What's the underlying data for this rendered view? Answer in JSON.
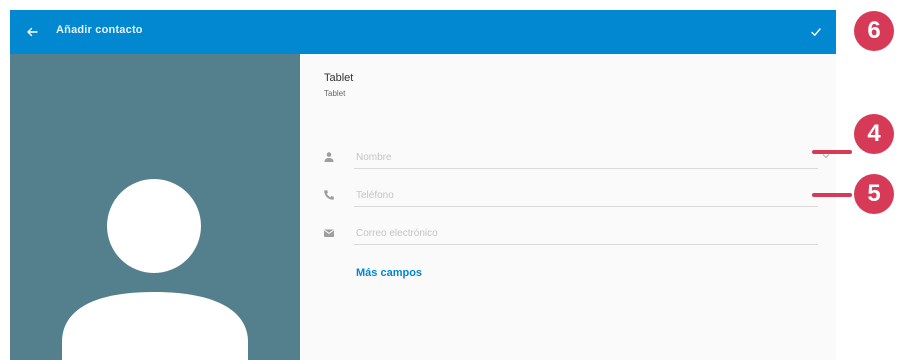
{
  "appbar": {
    "title": "Añadir contacto",
    "back_icon": "arrow-left-icon",
    "save_icon": "checkmark-icon",
    "background_color": "#0288d1"
  },
  "photo_panel": {
    "background_color": "#54808d",
    "avatar_icon": "person-silhouette-icon"
  },
  "account": {
    "name": "Tablet",
    "type": "Tablet"
  },
  "fields": [
    {
      "name": "name-field",
      "icon": "person-icon",
      "placeholder": "Nombre",
      "value": "",
      "expandable": true
    },
    {
      "name": "phone-field",
      "icon": "phone-icon",
      "placeholder": "Teléfono",
      "value": ""
    },
    {
      "name": "email-field",
      "icon": "envelope-icon",
      "placeholder": "Correo electrónico",
      "value": ""
    }
  ],
  "more_fields_label": "Más campos",
  "callouts": [
    {
      "label": "6"
    },
    {
      "label": "4"
    },
    {
      "label": "5"
    }
  ],
  "accent_color": "#d63a56"
}
